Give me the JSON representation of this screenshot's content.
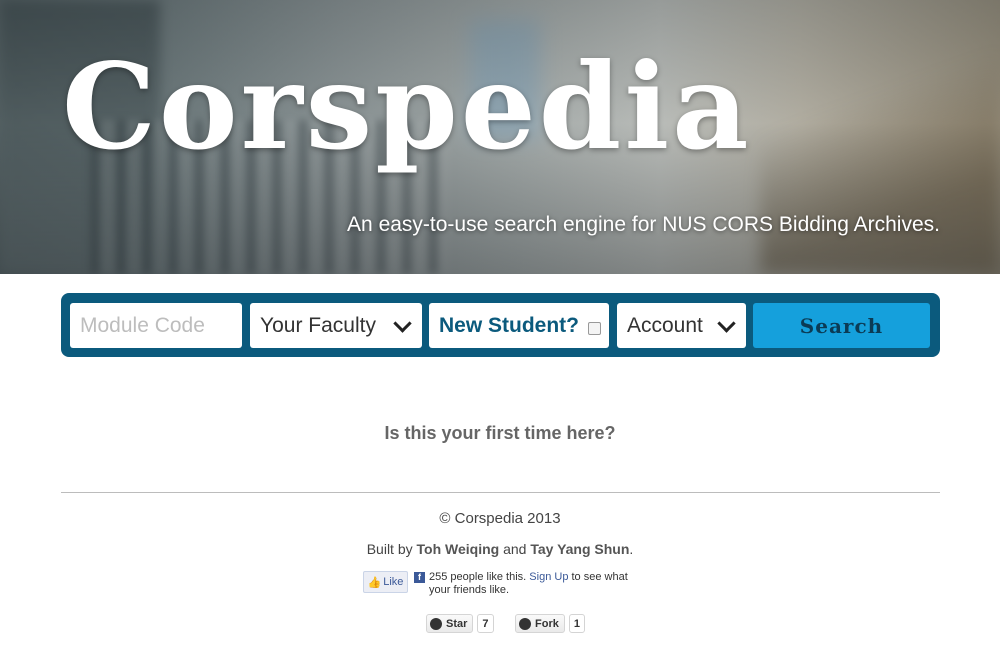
{
  "hero": {
    "title": "Corspedia",
    "tagline": "An easy-to-use search engine for NUS CORS Bidding Archives."
  },
  "search": {
    "module_placeholder": "Module Code",
    "faculty_label": "Your Faculty",
    "new_student_label": "New Student?",
    "account_label": "Account",
    "button_label": "Search",
    "bar_color": "#0b5a7d",
    "button_color": "#15a0dc"
  },
  "main": {
    "first_time_text": "Is this your first time here?"
  },
  "footer": {
    "copyright": "© Corspedia 2013",
    "built_by_prefix": "Built by",
    "author1": "Toh Weiqing",
    "and": "and",
    "author2": "Tay Yang Shun",
    "period": "."
  },
  "facebook": {
    "like_label": "Like",
    "count_text": "255 people like this.",
    "signup_link": "Sign Up",
    "suffix_text": "to see what your friends like."
  },
  "github": {
    "star_label": "Star",
    "star_count": "7",
    "fork_label": "Fork",
    "fork_count": "1"
  }
}
